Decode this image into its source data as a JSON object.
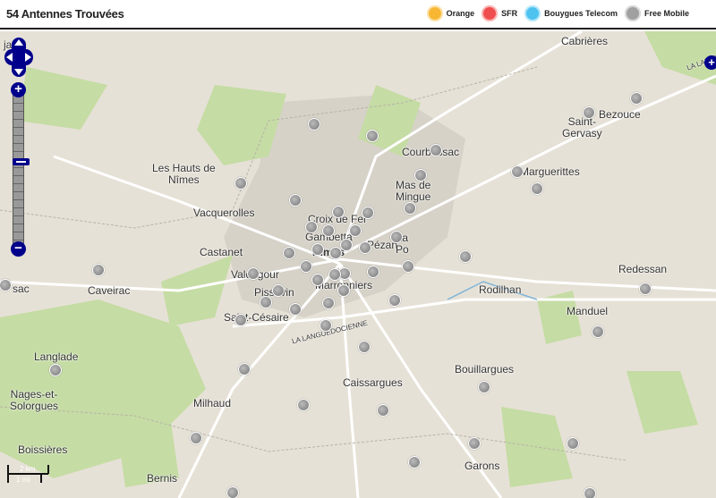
{
  "header": {
    "title": "54 Antennes Trouvées"
  },
  "legend": [
    {
      "label": "Orange",
      "color": "#f7b733"
    },
    {
      "label": "SFR",
      "color": "#f04e4e"
    },
    {
      "label": "Bouygues Telecom",
      "color": "#4ec3f0"
    },
    {
      "label": "Free Mobile",
      "color": "#a0a0a0"
    }
  ],
  "map": {
    "places": [
      "Cabrières",
      "Bezouce",
      "Saint-\nGervasy",
      "Courbessac",
      "Marguerittes",
      "Les Hauts de\nNîmes",
      "Mas de\nMingue",
      "Vacquerolles",
      "Croix de Fer",
      "Gambetta",
      "Nîmes",
      "Pézan",
      "La\nPo",
      "Castanet",
      "Valdegour",
      "Pissevin",
      "Marronniers",
      "Redessan",
      "Caveirac",
      "Rodilhan",
      "Manduel",
      "Saint-Césaire",
      "Langlade",
      "Bouillargues",
      "Nages-et-\nSolorgues",
      "Caissargues",
      "Milhaud",
      "Boissières",
      "Bernis",
      "Garons",
      "sac",
      "jan"
    ],
    "roads": [
      "LA LANGUEDOCIENNE",
      "LA LANGUEDOCIENNE"
    ],
    "marker_count": 54
  },
  "controls": {
    "zoom_in": "+",
    "zoom_out": "−"
  },
  "scale": {
    "km": "2 km",
    "mi": "1 mi"
  }
}
